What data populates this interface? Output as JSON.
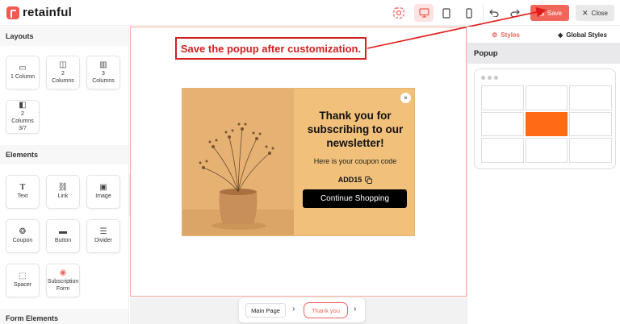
{
  "app": {
    "name": "retainful"
  },
  "toolbar": {
    "save_label": "Save",
    "close_label": "Close",
    "accent": "#f0665a"
  },
  "left_panel": {
    "layouts_title": "Layouts",
    "layouts": [
      {
        "label": "1 Column",
        "icon": "one-column-icon"
      },
      {
        "label": "2 Columns",
        "icon": "two-columns-icon"
      },
      {
        "label": "3 Columns",
        "icon": "three-columns-icon"
      },
      {
        "label": "2 Columns 3/7",
        "icon": "two-columns-37-icon"
      }
    ],
    "elements_title": "Elements",
    "elements": [
      {
        "label": "Text",
        "icon": "text-icon"
      },
      {
        "label": "Link",
        "icon": "link-icon"
      },
      {
        "label": "Image",
        "icon": "image-icon"
      },
      {
        "label": "Coupon",
        "icon": "coupon-icon"
      },
      {
        "label": "Button",
        "icon": "button-icon"
      },
      {
        "label": "Divider",
        "icon": "divider-icon"
      },
      {
        "label": "Spacer",
        "icon": "spacer-icon"
      },
      {
        "label": "Subscription Form",
        "icon": "subscription-form-icon"
      }
    ],
    "form_elements_title": "Form Elements"
  },
  "annotation": {
    "text": "Save the popup after customization."
  },
  "popup": {
    "title": "Thank you for subscribing to our newsletter!",
    "subtitle": "Here is your coupon code",
    "coupon_code": "ADD15",
    "button_label": "Continue Shopping",
    "close_glyph": "×"
  },
  "page_nav": {
    "main_page": "Main Page",
    "thank_you": "Thank you"
  },
  "right_panel": {
    "tabs": [
      {
        "label": "Styles",
        "active": true
      },
      {
        "label": "Global Styles",
        "active": false
      }
    ],
    "section_title": "Popup",
    "position_grid": {
      "rows": 3,
      "cols": 3,
      "selected": "middle-right"
    }
  }
}
